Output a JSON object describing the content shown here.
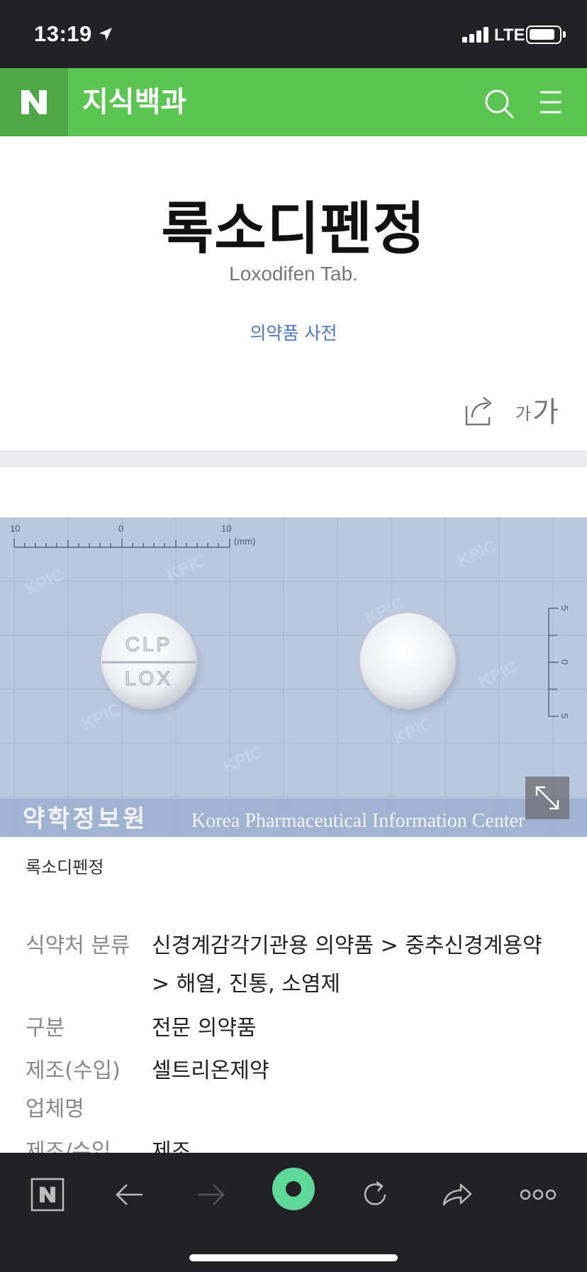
{
  "status_bar": {
    "time": "13:19",
    "network": "LTE"
  },
  "header": {
    "logo_text": "N",
    "title": "지식백과"
  },
  "article": {
    "title": "록소디펜정",
    "subtitle": "Loxodifen Tab.",
    "dictionary_link": "의약품 사전",
    "font_size_small": "가",
    "font_size_large": "가"
  },
  "image": {
    "ruler_labels": [
      "10",
      "0",
      "10",
      "(mm)"
    ],
    "side_ruler_labels": [
      "5",
      "0",
      "5"
    ],
    "pill_imprint_top": "CLP",
    "pill_imprint_bottom": "LOX",
    "watermark": "KPIC",
    "banner_korean": "약학정보원",
    "banner_english": "Korea Pharmaceutical Information Center",
    "caption": "록소디펜정"
  },
  "info_rows": [
    {
      "label": "식약처 분류",
      "value_line1": "신경계감각기관용 의약품 > 중추신경계용약",
      "value_line2": "> 해열, 진통, 소염제"
    },
    {
      "label": "구분",
      "value_line1": "전문 의약품"
    },
    {
      "label_line1": "제조(수입)",
      "label_line2": "업체명",
      "value_line1": "셀트리온제약"
    },
    {
      "label": "제조/수입",
      "value_line1": "제조"
    }
  ],
  "colors": {
    "header_green": "#5bc552",
    "logo_green": "#4fa846",
    "link_blue": "#4a78c8",
    "dark_bar": "#222226",
    "toolbar_accent": "#5fd99a"
  },
  "toolbar_icons": [
    "naver-home-icon",
    "back-arrow-icon",
    "forward-arrow-icon",
    "green-dot-icon",
    "refresh-icon",
    "share-icon",
    "more-icon"
  ]
}
